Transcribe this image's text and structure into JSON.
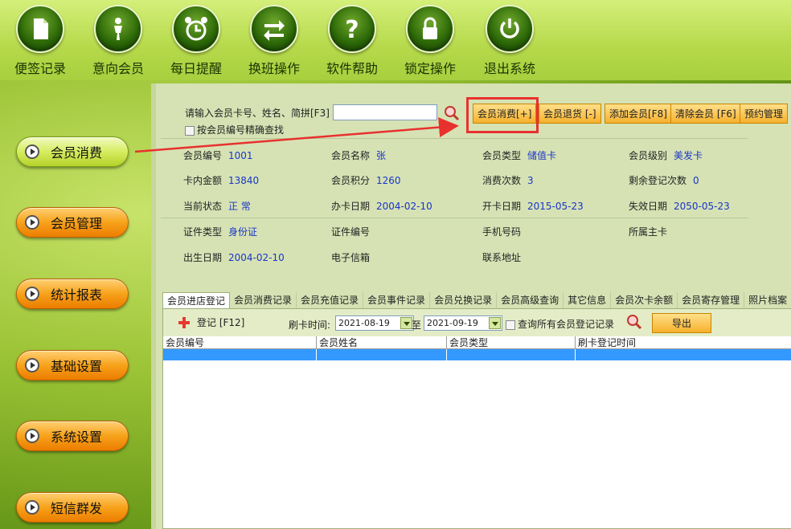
{
  "toolbar": {
    "items": [
      {
        "label": "便签记录",
        "icon": "note-icon"
      },
      {
        "label": "意向会员",
        "icon": "person-icon"
      },
      {
        "label": "每日提醒",
        "icon": "alarm-clock-icon"
      },
      {
        "label": "换班操作",
        "icon": "swap-arrows-icon"
      },
      {
        "label": "软件帮助",
        "icon": "help-icon"
      },
      {
        "label": "锁定操作",
        "icon": "lock-icon"
      },
      {
        "label": "退出系统",
        "icon": "power-icon"
      }
    ]
  },
  "nav": {
    "items": [
      {
        "label": "会员消费",
        "active": true
      },
      {
        "label": "会员管理"
      },
      {
        "label": "统计报表"
      },
      {
        "label": "基础设置"
      },
      {
        "label": "系统设置"
      },
      {
        "label": "短信群发"
      }
    ]
  },
  "search": {
    "label": "请输入会员卡号、姓名、简拼[F3]",
    "value": "",
    "exact_label": "按会员编号精确查找"
  },
  "actions": {
    "consume": "会员消费[+]",
    "refund": "会员退货 [-]",
    "add": "添加会员[F8]",
    "clear": "清除会员 [F6]",
    "booking": "预约管理"
  },
  "info": {
    "member_no_k": "会员编号",
    "member_no_v": "1001",
    "member_name_k": "会员名称",
    "member_name_v": "张",
    "member_type_k": "会员类型",
    "member_type_v": "储值卡",
    "member_level_k": "会员级别",
    "member_level_v": "美发卡",
    "balance_k": "卡内金额",
    "balance_v": "13840",
    "points_k": "会员积分",
    "points_v": "1260",
    "consume_count_k": "消费次数",
    "consume_count_v": "3",
    "remaining_k": "剩余登记次数",
    "remaining_v": "0",
    "status_k": "当前状态",
    "status_v": "正 常",
    "issue_date_k": "办卡日期",
    "issue_date_v": "2004-02-10",
    "open_date_k": "开卡日期",
    "open_date_v": "2015-05-23",
    "expire_date_k": "失效日期",
    "expire_date_v": "2050-05-23",
    "id_type_k": "证件类型",
    "id_type_v": "身份证",
    "id_no_k": "证件编号",
    "phone_k": "手机号码",
    "main_card_k": "所属主卡",
    "birth_k": "出生日期",
    "birth_v": "2004-02-10",
    "email_k": "电子信箱",
    "address_k": "联系地址"
  },
  "tabs": [
    "会员进店登记",
    "会员消费记录",
    "会员充值记录",
    "会员事件记录",
    "会员兑换记录",
    "会员高级查询",
    "其它信息",
    "会员次卡余额",
    "会员寄存管理",
    "照片档案"
  ],
  "panel": {
    "register_label": "登记 [F12]",
    "swipe_time_label": "刷卡时间:",
    "date_from": "2021-08-19",
    "to_label": "至",
    "date_to": "2021-09-19",
    "all_label": "查询所有会员登记记录",
    "export_label": "导出"
  },
  "table": {
    "columns": [
      "会员编号",
      "会员姓名",
      "会员类型",
      "刷卡登记时间"
    ]
  },
  "colors": {
    "highlight": "#e8312f",
    "selected_row": "#3399ff",
    "value_text": "#1a35c8"
  }
}
